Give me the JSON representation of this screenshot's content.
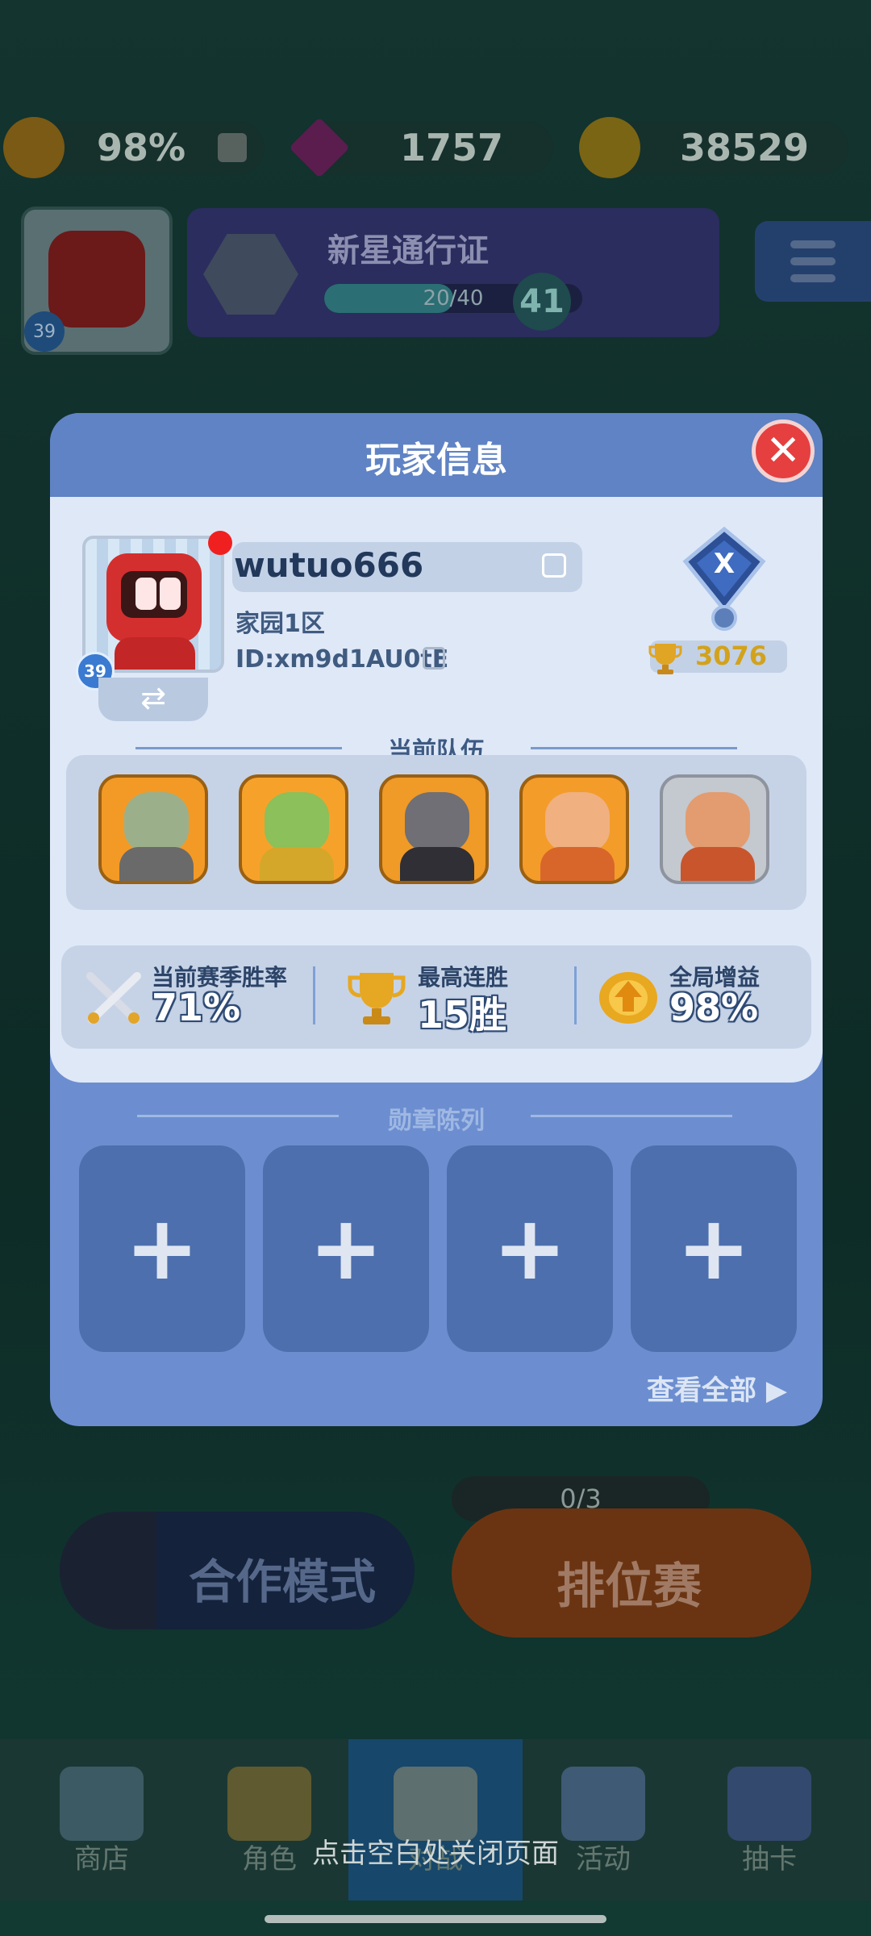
{
  "background": {
    "resources": [
      {
        "name": "global-buff",
        "value": "98%"
      },
      {
        "name": "gems",
        "value": "1757"
      },
      {
        "name": "coins",
        "value": "38529"
      }
    ],
    "avatar_level": "39",
    "pass": {
      "title": "新星通行证",
      "progress_text": "20/40",
      "progress": 0.5,
      "level": "41"
    },
    "modes": {
      "coop_label": "合作模式",
      "ranked_label": "排位赛",
      "ranked_count": "0/3"
    },
    "tabs": [
      {
        "label": "商店",
        "icon": "shop-icon"
      },
      {
        "label": "角色",
        "icon": "character-icon"
      },
      {
        "label": "对战",
        "icon": "battle-icon"
      },
      {
        "label": "活动",
        "icon": "event-icon"
      },
      {
        "label": "抽卡",
        "icon": "gacha-icon"
      }
    ],
    "close_hint": "点击空白处关闭页面"
  },
  "modal": {
    "title": "玩家信息",
    "close_icon": "close-icon",
    "player": {
      "name": "wutuo666",
      "server": "家园1区",
      "id": "ID:xm9d1AU0tE",
      "level": "39",
      "swap_icon": "swap-arrows-icon",
      "rank_letter": "X",
      "trophies": "3076"
    },
    "team_title": "当前队伍",
    "team": [
      {
        "name": "bomber-hero"
      },
      {
        "name": "goblin-king-hero"
      },
      {
        "name": "dark-knight-hero"
      },
      {
        "name": "warrior-king-hero"
      },
      {
        "name": "barbarian-hero"
      }
    ],
    "stats": [
      {
        "label": "当前赛季胜率",
        "value": "71%",
        "icon": "crossed-swords-icon"
      },
      {
        "label": "最高连胜",
        "value": "15胜",
        "icon": "trophy-icon"
      },
      {
        "label": "全局增益",
        "value": "98%",
        "icon": "buff-icon"
      }
    ],
    "medals_title": "勋章陈列",
    "medal_slots": [
      "+",
      "+",
      "+",
      "+"
    ],
    "view_all": "查看全部 ▶"
  },
  "colors": {
    "modal_bg": "#6c8ed0",
    "panel_bg": "#dfe8f7",
    "close_red": "#e53f3f",
    "trophy_gold": "#d3a21c"
  }
}
